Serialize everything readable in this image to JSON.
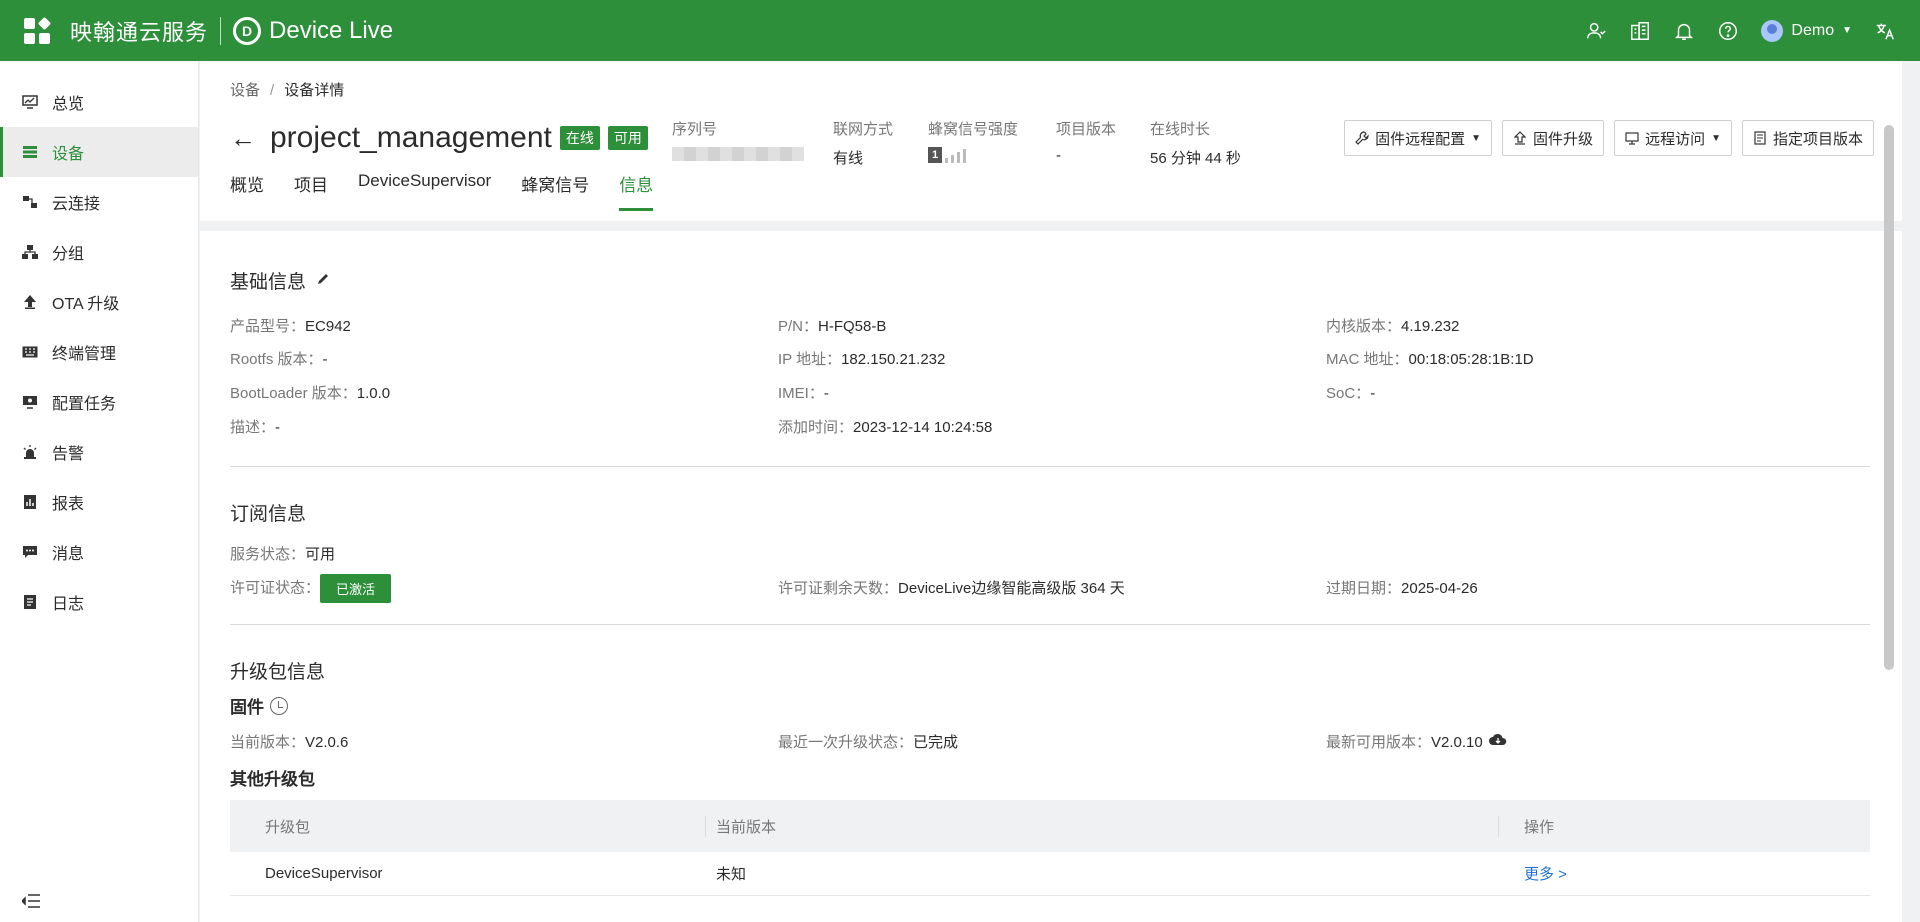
{
  "topbar": {
    "brand_cn": "映翰通云服务",
    "logo_mark": "D",
    "brand_en": "Device Live",
    "user": "Demo"
  },
  "sidebar": {
    "items": [
      {
        "label": "总览",
        "icon": "monitor-icon"
      },
      {
        "label": "设备",
        "icon": "server-icon"
      },
      {
        "label": "云连接",
        "icon": "link-icon"
      },
      {
        "label": "分组",
        "icon": "hierarchy-icon"
      },
      {
        "label": "OTA 升级",
        "icon": "upload-arrow-icon"
      },
      {
        "label": "终端管理",
        "icon": "keyboard-icon"
      },
      {
        "label": "配置任务",
        "icon": "config-screen-icon"
      },
      {
        "label": "告警",
        "icon": "alarm-icon"
      },
      {
        "label": "报表",
        "icon": "report-icon"
      },
      {
        "label": "消息",
        "icon": "message-icon"
      },
      {
        "label": "日志",
        "icon": "log-icon"
      }
    ]
  },
  "breadcrumb": {
    "root": "设备",
    "sep": "/",
    "current": "设备详情"
  },
  "device": {
    "back_arrow": "←",
    "name": "project_management",
    "tag_online": "在线",
    "tag_available": "可用"
  },
  "meta": {
    "serial_label": "序列号",
    "network_label": "联网方式",
    "network_value": "有线",
    "signal_label": "蜂窝信号强度",
    "signal_value": "1",
    "project_version_label": "项目版本",
    "project_version_value": "-",
    "uptime_label": "在线时长",
    "uptime_value": "56 分钟 44 秒"
  },
  "buttons": {
    "fw_config": "固件远程配置",
    "fw_upgrade": "固件升级",
    "remote_access": "远程访问",
    "assign_version": "指定项目版本"
  },
  "tabs": [
    {
      "label": "概览",
      "active": false
    },
    {
      "label": "项目",
      "active": false
    },
    {
      "label": "DeviceSupervisor",
      "active": false
    },
    {
      "label": "蜂窝信号",
      "active": false
    },
    {
      "label": "信息",
      "active": true
    }
  ],
  "basic": {
    "title": "基础信息",
    "model_label": "产品型号：",
    "model_value": "EC942",
    "pn_label": "P/N：",
    "pn_value": "H-FQ58-B",
    "kernel_label": "内核版本：",
    "kernel_value": "4.19.232",
    "rootfs_label": "Rootfs 版本：",
    "rootfs_value": "-",
    "ip_label": "IP 地址：",
    "ip_value": "182.150.21.232",
    "mac_label": "MAC 地址：",
    "mac_value": "00:18:05:28:1B:1D",
    "bootloader_label": "BootLoader 版本：",
    "bootloader_value": "1.0.0",
    "imei_label": "IMEI：",
    "imei_value": "-",
    "soc_label": "SoC：",
    "soc_value": "-",
    "desc_label": "描述：",
    "desc_value": "-",
    "added_label": "添加时间：",
    "added_value": "2023-12-14 10:24:58"
  },
  "subscription": {
    "title": "订阅信息",
    "service_label": "服务状态：",
    "service_value": "可用",
    "license_label": "许可证状态：",
    "license_value": "已激活",
    "remaining_label": "许可证剩余天数：",
    "remaining_value": "DeviceLive边缘智能高级版 364 天",
    "expire_label": "过期日期：",
    "expire_value": "2025-04-26"
  },
  "upgrade": {
    "title": "升级包信息",
    "firmware_title": "固件",
    "current_label": "当前版本：",
    "current_value": "V2.0.6",
    "last_status_label": "最近一次升级状态：",
    "last_status_value": "已完成",
    "latest_label": "最新可用版本：",
    "latest_value": "V2.0.10",
    "other_title": "其他升级包",
    "table": {
      "headers": [
        "升级包",
        "当前版本",
        "操作"
      ],
      "rows": [
        {
          "package": "DeviceSupervisor",
          "version": "未知",
          "action": "更多 >"
        }
      ]
    }
  },
  "colors": {
    "primary": "#2d8f3a",
    "link": "#1f6fd0"
  }
}
